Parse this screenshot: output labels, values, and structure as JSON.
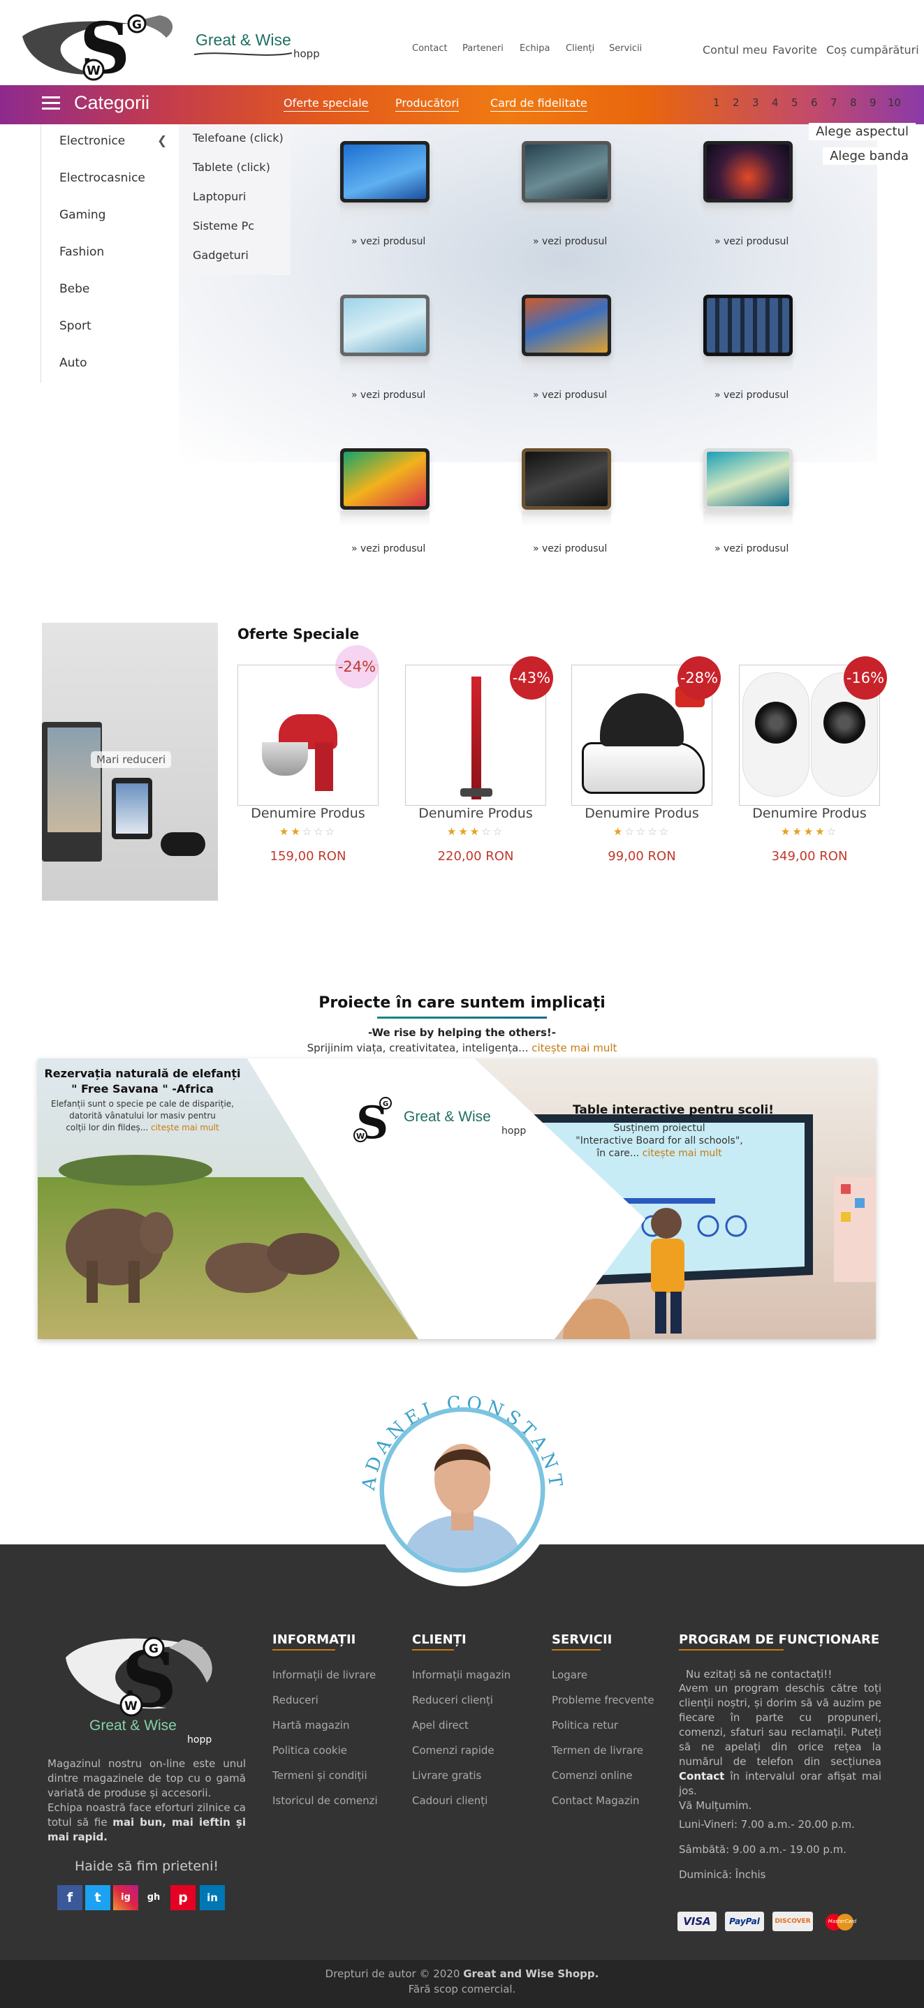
{
  "header": {
    "brand": "Great & Wise",
    "brand_suffix": "hopp",
    "top_links": [
      "Contact",
      "Parteneri",
      "Echipa",
      "Clienți",
      "Servicii"
    ],
    "account_links": [
      "Contul meu",
      "Favorite",
      "Coș cumpărături"
    ]
  },
  "category_bar": {
    "title": "Categorii",
    "nav": [
      "Oferte speciale",
      "Producători",
      "Card de fidelitate"
    ],
    "pages": [
      "1",
      "2",
      "3",
      "4",
      "5",
      "6",
      "7",
      "8",
      "9",
      "10"
    ]
  },
  "sidebar": {
    "items": [
      "Electronice",
      "Electrocasnice",
      "Gaming",
      "Fashion",
      "Bebe",
      "Sport",
      "Auto"
    ],
    "arrow": "❮"
  },
  "submenu": {
    "items": [
      "Telefoane (click)",
      "Tablete (click)",
      "Laptopuri",
      "Sisteme Pc",
      "Gadgeturi"
    ]
  },
  "hero_options": [
    "Alege aspectul",
    "Alege banda"
  ],
  "products_grid": {
    "link_label": "» vezi produsul",
    "count": 9
  },
  "special_offers": {
    "promo_label": "Mari reduceri",
    "title": "Oferte Speciale",
    "products": [
      {
        "name": "Denumire Produs",
        "discount": "-24%",
        "price": "159,00 RON",
        "rating": 2
      },
      {
        "name": "Denumire Produs",
        "discount": "-43%",
        "price": "220,00 RON",
        "rating": 3
      },
      {
        "name": "Denumire Produs",
        "discount": "-28%",
        "price": "99,00 RON",
        "rating": 1
      },
      {
        "name": "Denumire Produs",
        "discount": "-16%",
        "price": "349,00 RON",
        "rating": 4
      }
    ]
  },
  "projects": {
    "title": "Proiecte în care suntem implicați",
    "subtitle": "-We rise by helping the others!-",
    "text": "Sprijinim viața, creativitatea, inteligența...",
    "link": "citește mai mult",
    "left": {
      "title1": "Rezervația naturală de elefanți",
      "title2": "\" Free Savana \" -Africa",
      "text1": "Elefanții sunt o specie pe cale de dispariție,",
      "text2": "datorită vânatului lor masiv pentru",
      "text3": "colții lor din fildeș...",
      "link": "citește mai mult"
    },
    "right": {
      "title": "Table interactive pentru școli!",
      "text1": "Susținem proiectul",
      "text2": "\"Interactive Board for all schools\",",
      "text3": "în care...",
      "link": "citește mai mult"
    }
  },
  "team": {
    "name": "AVADANEI CONSTANTIN"
  },
  "footer": {
    "about": {
      "tagline": "Haide să fim prieteni!",
      "p1": "Magazinul nostru on-line este unul dintre magazinele de top cu o gamă variată de produse și accesorii.",
      "p2a": "Echipa noastră face eforturi zilnice ca totul să fie",
      "p2b": "mai bun, mai ieftin și mai rapid."
    },
    "columns": [
      {
        "title": "INFORMAȚII",
        "items": [
          "Informații de livrare",
          "Reduceri",
          "Hartă magazin",
          "Politica cookie",
          "Termeni și condiții",
          "Istoricul de comenzi"
        ]
      },
      {
        "title": "CLIENȚI",
        "items": [
          "Informații magazin",
          "Reduceri clienți",
          "Apel direct",
          "Comenzi rapide",
          "Livrare gratis",
          "Cadouri clienți"
        ]
      },
      {
        "title": "SERVICII",
        "items": [
          "Logare",
          "Probleme frecvente",
          "Politica retur",
          "Termen de livrare",
          "Comenzi online",
          "Contact Magazin"
        ]
      }
    ],
    "program": {
      "title": "PROGRAM DE FUNCȚIONARE",
      "intro": "Nu ezitați să ne contactați!!",
      "body_a": "Avem un program deschis către toți clienții noștri, și dorim să vă auzim pe fiecare în parte cu propuneri, comenzi, sfaturi sau reclamații. Puteți să ne apelați din orice rețea la numărul de telefon din secțiunea",
      "body_b": "Contact",
      "body_c": "în intervalul orar afișat mai jos.",
      "thanks": "Vă Mulțumim.",
      "weekdays": "Luni-Vineri: 7.00 a.m.- 20.00 p.m.",
      "saturday": "Sâmbătă: 9.00 a.m.- 19.00 p.m.",
      "sunday": "Duminică: Închis"
    },
    "social": [
      "f",
      "t",
      "ig",
      "gh",
      "p",
      "in"
    ],
    "payments": [
      "VISA",
      "PayPal",
      "DISCOVER",
      "MasterCard"
    ],
    "copyright_a": "Drepturi de autor © 2020",
    "copyright_b": "Great and Wise Shopp.",
    "copyright_c": "Fără scop comercial."
  },
  "colors": {
    "accent": "#c77a10",
    "brand_green": "#1f6f61",
    "badge_red": "#c8222a",
    "footer_bg": "#333333"
  }
}
